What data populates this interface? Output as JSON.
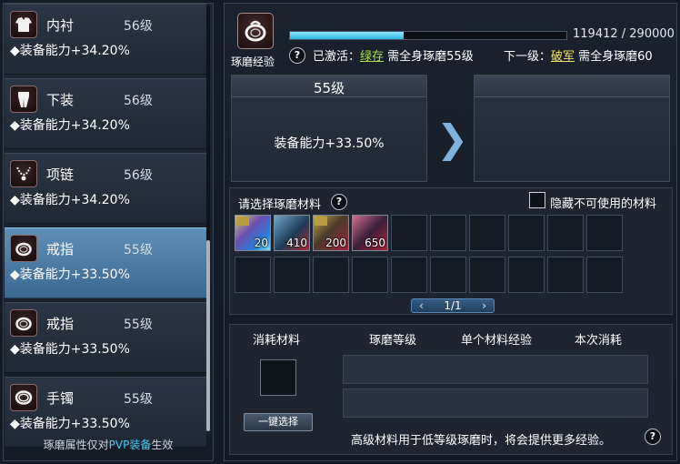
{
  "left_list": {
    "items": [
      {
        "name": "内衬",
        "level": "56级",
        "ability": "◆装备能力+34.20%"
      },
      {
        "name": "下装",
        "level": "56级",
        "ability": "◆装备能力+34.20%"
      },
      {
        "name": "项链",
        "level": "56级",
        "ability": "◆装备能力+34.20%"
      },
      {
        "name": "戒指",
        "level": "55级",
        "ability": "◆装备能力+33.50%"
      },
      {
        "name": "戒指",
        "level": "55级",
        "ability": "◆装备能力+33.50%"
      },
      {
        "name": "手镯",
        "level": "55级",
        "ability": "◆装备能力+33.50%"
      }
    ],
    "selected_index": 3,
    "footer_prefix": "琢磨属性仅对",
    "footer_highlight": "PVP装备",
    "footer_suffix": "生效"
  },
  "header": {
    "icon_label": "琢磨经验",
    "exp_value": "119412 / 290000",
    "exp_fraction": 0.4118,
    "help": "?",
    "activated_prefix": "已激活：",
    "activated_set": "绿存",
    "activated_req": " 需全身琢磨55级",
    "next_prefix": "下一级：",
    "next_set": "破军",
    "next_req": " 需全身琢磨60"
  },
  "level_panel": {
    "current_level": "55级",
    "current_ability": "装备能力+33.50%",
    "arrow": "❯"
  },
  "materials": {
    "title": "请选择琢磨材料",
    "help": "?",
    "hide_label": "隐藏不可使用的材料",
    "slots": [
      {
        "count": "20"
      },
      {
        "count": "410"
      },
      {
        "count": "200"
      },
      {
        "count": "650"
      }
    ],
    "pager": "1/1",
    "pager_prev": "‹",
    "pager_next": "›"
  },
  "consume": {
    "col_material": "消耗材料",
    "col_level": "琢磨等级",
    "col_exp": "单个材料经验",
    "col_cost": "本次消耗",
    "one_key_button": "一键选择",
    "hint": "高级材料用于低等级琢磨时，将会提供更多经验。",
    "help": "?"
  },
  "colors": {
    "accent_cyan": "#48c8f0",
    "set_yellow": "#f0e36b",
    "set_green": "#a6e04a",
    "selected_row": "#4f81ab"
  },
  "icons": {
    "list": [
      "shirt-icon",
      "pants-icon",
      "necklace-icon",
      "ring-icon",
      "ring-icon",
      "bracelet-icon"
    ],
    "main": "ring-icon"
  }
}
